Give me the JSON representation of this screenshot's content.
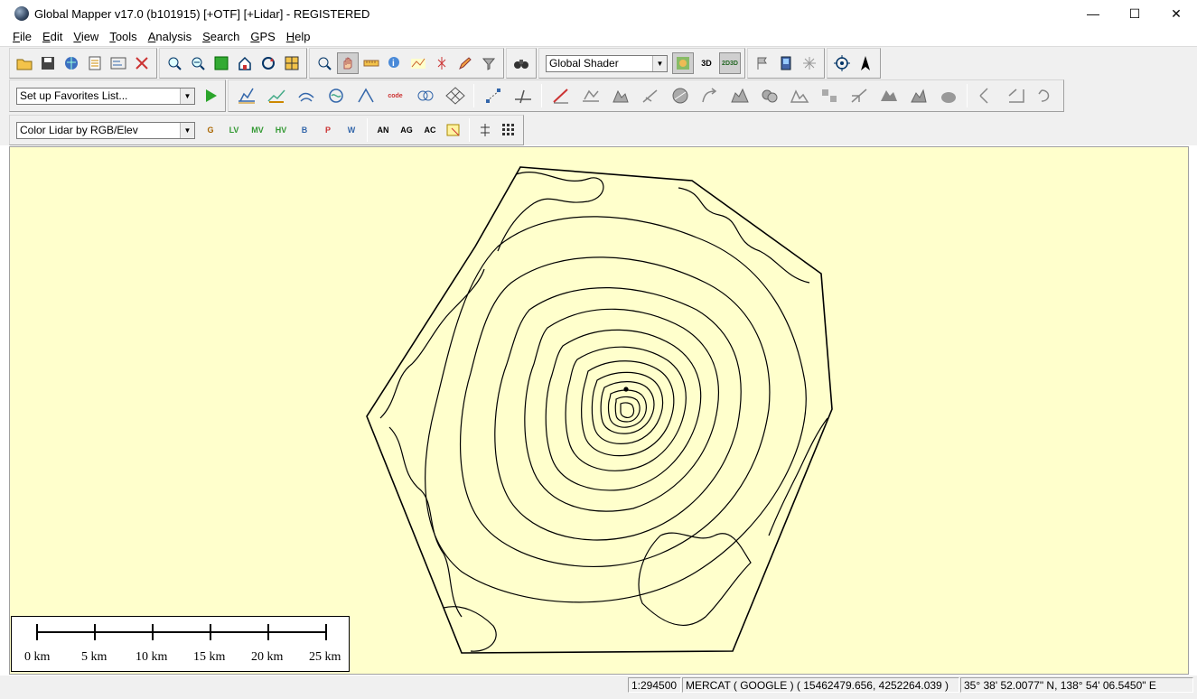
{
  "window": {
    "title": "Global Mapper v17.0 (b101915) [+OTF] [+Lidar] - REGISTERED",
    "controls": [
      "—",
      "☐",
      "✕"
    ]
  },
  "menu": [
    {
      "key": "F",
      "rest": "ile"
    },
    {
      "key": "E",
      "rest": "dit"
    },
    {
      "key": "V",
      "rest": "iew"
    },
    {
      "key": "T",
      "rest": "ools"
    },
    {
      "key": "A",
      "rest": "nalysis"
    },
    {
      "key": "S",
      "rest": "earch"
    },
    {
      "key": "G",
      "rest": "PS"
    },
    {
      "key": "H",
      "rest": "elp"
    }
  ],
  "toolbar": {
    "shader_select": "Global Shader",
    "favorites_select": "Set up Favorites List...",
    "lidar_color_select": "Color Lidar by RGB/Elev",
    "lidar_buttons": [
      "G",
      "LV",
      "MV",
      "HV",
      "B",
      "P",
      "W"
    ],
    "analysis_buttons": [
      "AN",
      "AG",
      "AC"
    ],
    "view_3d_label": "3D",
    "view_2d3d_label": "2D3D",
    "code_label": "code"
  },
  "scale_bar": {
    "labels": [
      "0 km",
      "5 km",
      "10 km",
      "15 km",
      "20 km",
      "25 km"
    ]
  },
  "status": {
    "scale": "1:294500",
    "projection": "MERCAT ( GOOGLE ) ( 15462479.656, 4252264.039 )",
    "coords": "35° 38' 52.0077\" N, 138° 54' 06.5450\" E"
  },
  "colors": {
    "map_background": "#ffffcc",
    "chrome": "#f0f0f0",
    "contour": "#000000"
  }
}
